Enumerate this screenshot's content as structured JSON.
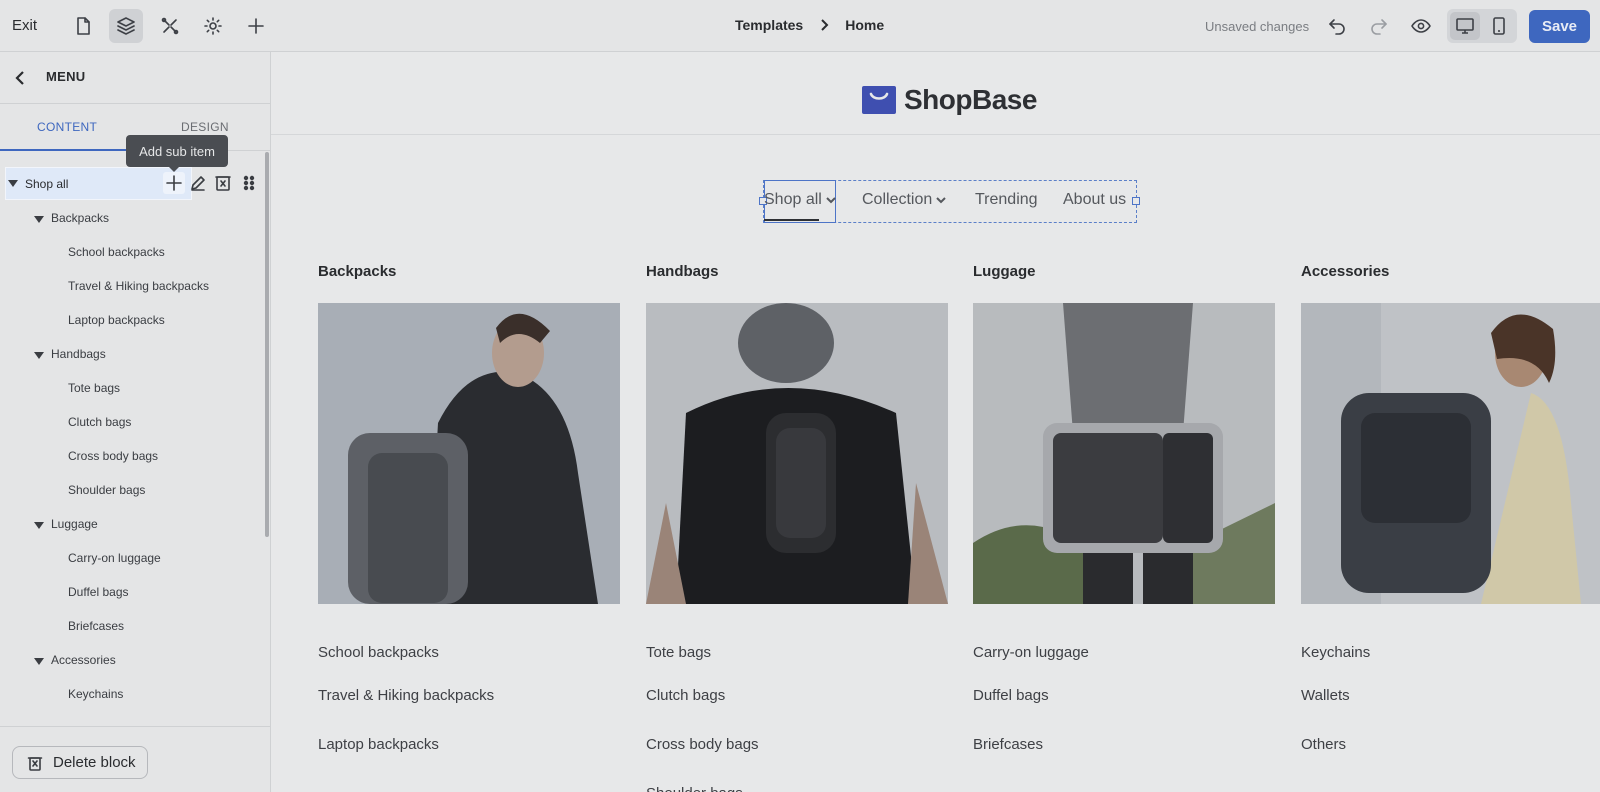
{
  "topbar": {
    "exit_label": "Exit",
    "breadcrumb": [
      "Templates",
      "Home"
    ],
    "status_text": "Unsaved changes",
    "save_label": "Save"
  },
  "panel": {
    "title": "MENU",
    "tabs": [
      "CONTENT",
      "DESIGN"
    ],
    "tooltip": "Add sub item",
    "selected_item": "Shop all",
    "tree": [
      {
        "label": "Backpacks",
        "level": 1
      },
      {
        "label": "School backpacks",
        "level": 2
      },
      {
        "label": "Travel & Hiking backpacks",
        "level": 2
      },
      {
        "label": "Laptop backpacks",
        "level": 2
      },
      {
        "label": "Handbags",
        "level": 1
      },
      {
        "label": "Tote bags",
        "level": 2
      },
      {
        "label": "Clutch bags",
        "level": 2
      },
      {
        "label": "Cross body bags",
        "level": 2
      },
      {
        "label": "Shoulder bags",
        "level": 2
      },
      {
        "label": "Luggage",
        "level": 1
      },
      {
        "label": "Carry-on luggage",
        "level": 2
      },
      {
        "label": "Duffel bags",
        "level": 2
      },
      {
        "label": "Briefcases",
        "level": 2
      },
      {
        "label": "Accessories",
        "level": 1
      },
      {
        "label": "Keychains",
        "level": 2
      }
    ],
    "delete_label": "Delete block"
  },
  "canvas": {
    "logo_text": "ShopBase",
    "nav": [
      "Shop all",
      "Collection",
      "Trending",
      "About us"
    ],
    "columns": [
      {
        "title": "Backpacks",
        "links": [
          "School backpacks",
          "Travel & Hiking backpacks",
          "Laptop backpacks"
        ]
      },
      {
        "title": "Handbags",
        "links": [
          "Tote bags",
          "Clutch bags",
          "Cross body bags",
          "Shoulder bags"
        ]
      },
      {
        "title": "Luggage",
        "links": [
          "Carry-on luggage",
          "Duffel bags",
          "Briefcases"
        ]
      },
      {
        "title": "Accessories",
        "links": [
          "Keychains",
          "Wallets",
          "Others"
        ]
      }
    ]
  },
  "colors": {
    "accent": "#3e67bf",
    "logo_blue": "#3f4fb0"
  }
}
